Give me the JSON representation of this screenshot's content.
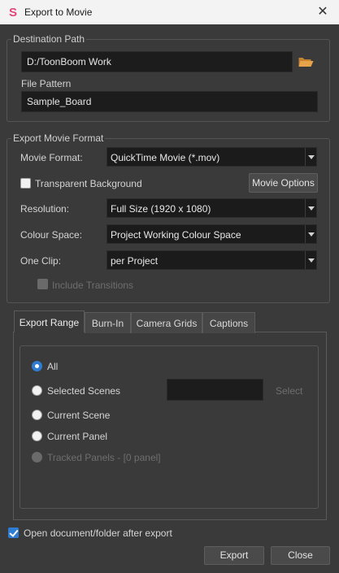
{
  "window": {
    "title": "Export to Movie",
    "close_glyph": "✕",
    "logo_letter": "S"
  },
  "destination": {
    "group_title": "Destination Path",
    "path_value": "D:/ToonBoom Work",
    "folder_icon": "folder-open-icon",
    "pattern_label": "File Pattern",
    "pattern_value": "Sample_Board"
  },
  "format": {
    "group_title": "Export Movie Format",
    "movie_format_label": "Movie Format:",
    "movie_format_value": "QuickTime Movie (*.mov)",
    "transparent_label": "Transparent Background",
    "transparent_checked": false,
    "movie_options_label": "Movie Options",
    "resolution_label": "Resolution:",
    "resolution_value": "Full Size (1920 x 1080)",
    "colour_space_label": "Colour Space:",
    "colour_space_value": "Project Working Colour Space",
    "one_clip_label": "One Clip:",
    "one_clip_value": "per Project",
    "include_transitions_label": "Include Transitions",
    "include_transitions_enabled": false
  },
  "tabs": [
    {
      "label": "Export Range",
      "active": true
    },
    {
      "label": "Burn-In",
      "active": false
    },
    {
      "label": "Camera Grids",
      "active": false
    },
    {
      "label": "Captions",
      "active": false
    }
  ],
  "range": {
    "all_label": "All",
    "selected_scenes_label": "Selected Scenes",
    "select_button_label": "Select",
    "current_scene_label": "Current Scene",
    "current_panel_label": "Current Panel",
    "tracked_panels_label": "Tracked Panels - [0 panel]",
    "selected_option": "All"
  },
  "footer": {
    "open_after_export_label": "Open document/folder after export",
    "open_after_export_checked": true,
    "export_label": "Export",
    "close_label": "Close"
  },
  "colors": {
    "background": "#3a3a3a",
    "accent": "#2f7dd3",
    "logo": "#e0457b",
    "folder": "#e8a24a"
  }
}
